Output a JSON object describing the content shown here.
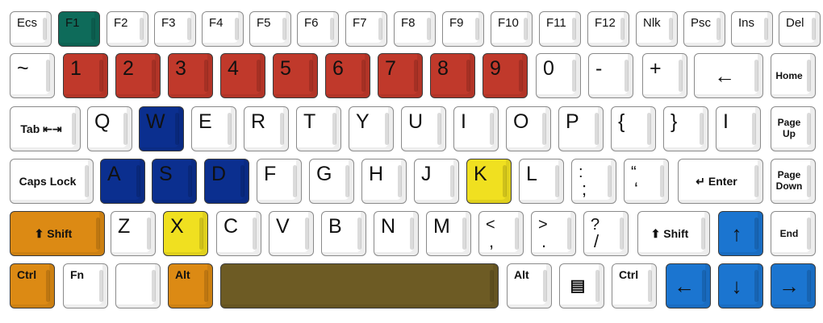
{
  "colors": {
    "f1": "#0e6b5a",
    "numbers": "#c0392b",
    "wasd": "#0b2f8f",
    "highlight": "#f0e020",
    "modifiers": "#dc8a14",
    "space": "#6d5b24",
    "arrows": "#1b75d0"
  },
  "rows": [
    [
      {
        "label": "Ecs"
      },
      {
        "label": "F1",
        "color": "f1"
      },
      {
        "label": "F2"
      },
      {
        "label": "F3"
      },
      {
        "label": "F4"
      },
      {
        "label": "F5"
      },
      {
        "label": "F6"
      },
      {
        "label": "F7"
      },
      {
        "label": "F8"
      },
      {
        "label": "F9"
      },
      {
        "label": "F10"
      },
      {
        "label": "F11"
      },
      {
        "label": "F12"
      },
      {
        "label": "Nlk"
      },
      {
        "label": "Psc"
      },
      {
        "label": "Ins"
      },
      {
        "label": "Del"
      }
    ],
    [
      {
        "label": "~",
        "big": true
      },
      {
        "label": "1",
        "big": true,
        "color": "numbers"
      },
      {
        "label": "2",
        "big": true,
        "color": "numbers"
      },
      {
        "label": "3",
        "big": true,
        "color": "numbers"
      },
      {
        "label": "4",
        "big": true,
        "color": "numbers"
      },
      {
        "label": "5",
        "big": true,
        "color": "numbers"
      },
      {
        "label": "6",
        "big": true,
        "color": "numbers"
      },
      {
        "label": "7",
        "big": true,
        "color": "numbers"
      },
      {
        "label": "8",
        "big": true,
        "color": "numbers"
      },
      {
        "label": "9",
        "big": true,
        "color": "numbers"
      },
      {
        "label": "0",
        "big": true
      },
      {
        "label": "-",
        "big": true
      },
      {
        "label": "+",
        "big": true
      },
      {
        "label": "←",
        "arrow": true,
        "wide": true
      },
      {
        "label": "Home",
        "tiny": true
      }
    ],
    [
      {
        "label": "Tab ⇤⇥",
        "wide": true
      },
      {
        "label": "Q",
        "big": true
      },
      {
        "label": "W",
        "big": true,
        "color": "wasd"
      },
      {
        "label": "E",
        "big": true
      },
      {
        "label": "R",
        "big": true
      },
      {
        "label": "T",
        "big": true
      },
      {
        "label": "Y",
        "big": true
      },
      {
        "label": "U",
        "big": true
      },
      {
        "label": "I",
        "big": true
      },
      {
        "label": "O",
        "big": true
      },
      {
        "label": "P",
        "big": true
      },
      {
        "label": "{",
        "big": true
      },
      {
        "label": "}",
        "big": true
      },
      {
        "label": "I",
        "big": true
      },
      {
        "label": "Page Up",
        "two": true
      }
    ],
    [
      {
        "label": "Caps Lock",
        "wide": true
      },
      {
        "label": "A",
        "big": true,
        "color": "wasd"
      },
      {
        "label": "S",
        "big": true,
        "color": "wasd"
      },
      {
        "label": "D",
        "big": true,
        "color": "wasd"
      },
      {
        "label": "F",
        "big": true
      },
      {
        "label": "G",
        "big": true
      },
      {
        "label": "H",
        "big": true
      },
      {
        "label": "J",
        "big": true
      },
      {
        "label": "K",
        "big": true,
        "color": "highlight"
      },
      {
        "label": "L",
        "big": true
      },
      {
        "label": ":",
        "alt": ";",
        "big": true
      },
      {
        "label": "“",
        "alt": "‘",
        "big": true
      },
      {
        "label": "↵ Enter",
        "wide": true
      },
      {
        "label": "Page Down",
        "two": true
      }
    ],
    [
      {
        "label": "⬆ Shift",
        "wide": true,
        "color": "modifiers"
      },
      {
        "label": "Z",
        "big": true
      },
      {
        "label": "X",
        "big": true,
        "color": "highlight"
      },
      {
        "label": "C",
        "big": true
      },
      {
        "label": "V",
        "big": true
      },
      {
        "label": "B",
        "big": true
      },
      {
        "label": "N",
        "big": true
      },
      {
        "label": "M",
        "big": true
      },
      {
        "label": "<",
        "alt": ",",
        "big": true
      },
      {
        "label": ">",
        "alt": ".",
        "big": true
      },
      {
        "label": "?",
        "alt": "/",
        "big": true
      },
      {
        "label": "⬆ Shift",
        "wide": true
      },
      {
        "label": "↑",
        "arrow": true,
        "color": "arrows"
      },
      {
        "label": "End",
        "tiny": true
      }
    ],
    [
      {
        "label": "Ctrl",
        "color": "modifiers"
      },
      {
        "label": "Fn"
      },
      {
        "label": ""
      },
      {
        "label": "Alt",
        "color": "modifiers"
      },
      {
        "label": "",
        "space": true,
        "color": "space"
      },
      {
        "label": "Alt"
      },
      {
        "label": "▤",
        "menu": true
      },
      {
        "label": "Ctrl"
      },
      {
        "label": "←",
        "arrow": true,
        "color": "arrows"
      },
      {
        "label": "↓",
        "arrow": true,
        "color": "arrows"
      },
      {
        "label": "→",
        "arrow": true,
        "color": "arrows"
      }
    ]
  ]
}
